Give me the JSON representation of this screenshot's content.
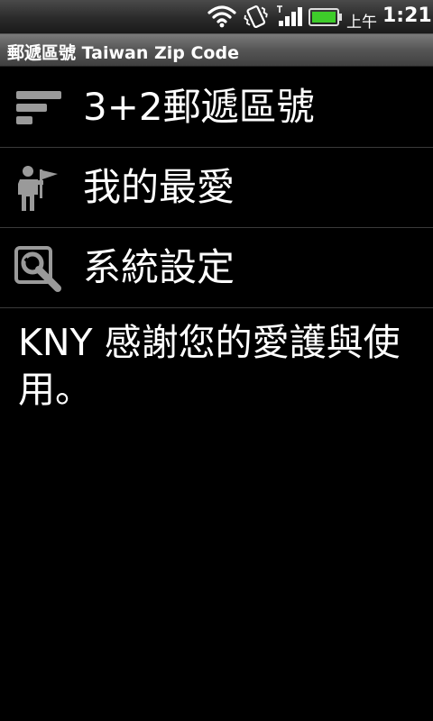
{
  "status_bar": {
    "ampm": "上午",
    "time": "1:21",
    "icons": [
      "wifi-icon",
      "vibrate-icon",
      "signal-icon",
      "battery-icon"
    ]
  },
  "title_bar": {
    "title": "郵遞區號 Taiwan Zip Code"
  },
  "menu": {
    "items": [
      {
        "label": "3+2郵遞區號",
        "icon": "list-icon"
      },
      {
        "label": "我的最愛",
        "icon": "person-flag-icon"
      },
      {
        "label": "系統設定",
        "icon": "wrench-icon"
      }
    ]
  },
  "message": {
    "text": "KNY 感謝您的愛護與使用。"
  },
  "colors": {
    "background": "#000000",
    "text": "#ffffff",
    "icon": "#9a9a9a",
    "divider": "#3a3a3a"
  }
}
